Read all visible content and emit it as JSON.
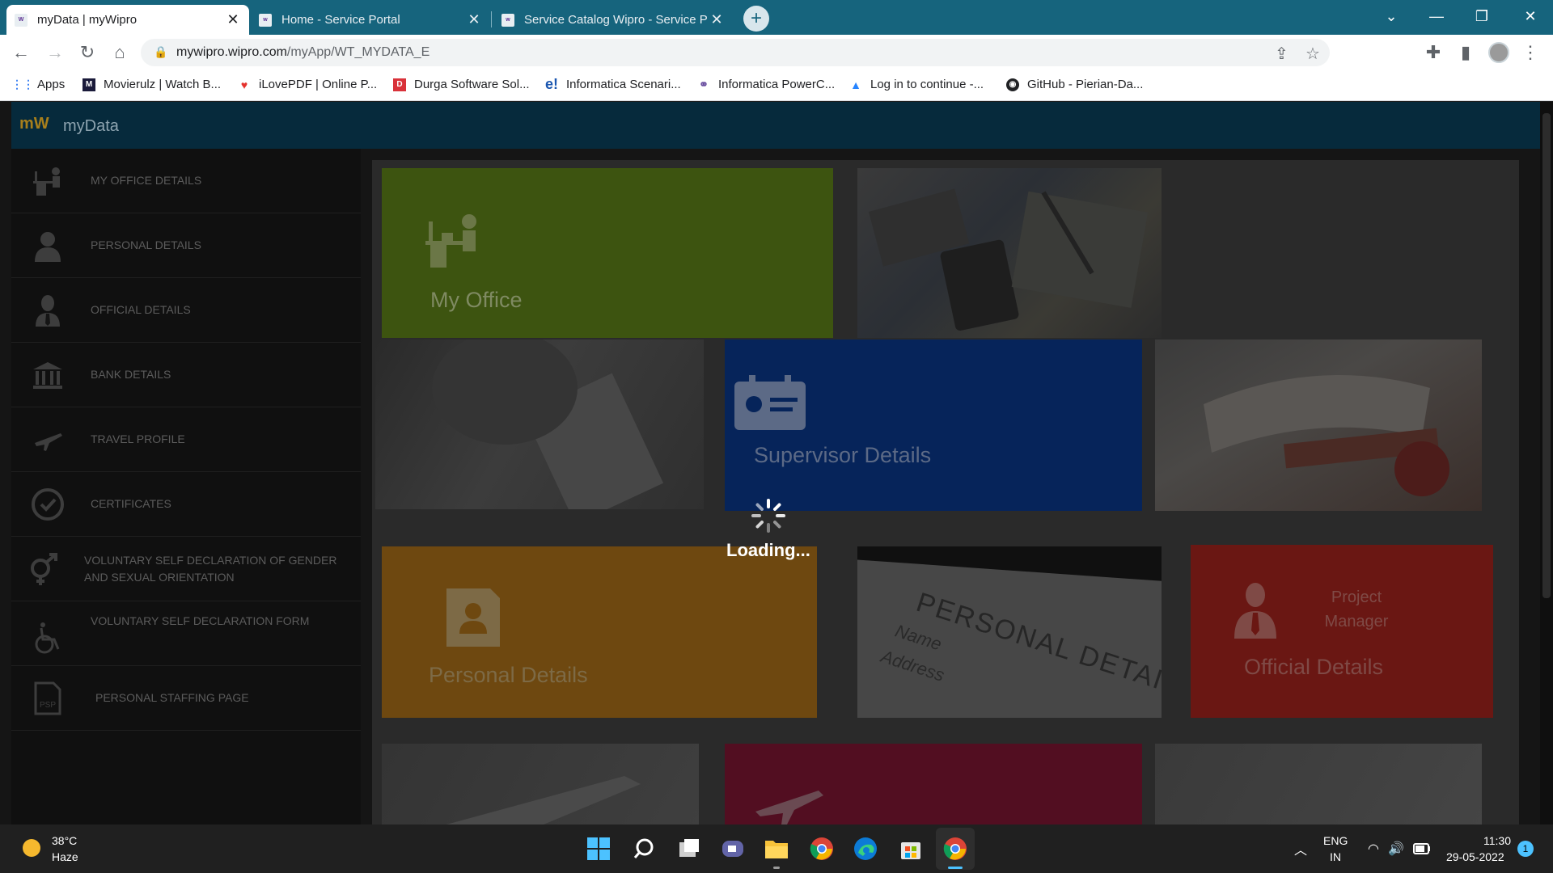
{
  "browser": {
    "tabs": [
      {
        "title": "myData | myWipro",
        "active": true
      },
      {
        "title": "Home - Service Portal",
        "active": false
      },
      {
        "title": "Service Catalog Wipro - Service P",
        "active": false
      }
    ],
    "url_host": "mywipro.wipro.com",
    "url_path": "/myApp/WT_MYDATA_E",
    "bookmarks": [
      {
        "label": "Apps",
        "icon": "apps-grid-icon"
      },
      {
        "label": "Movierulz | Watch B...",
        "icon": "movierulz-icon"
      },
      {
        "label": "iLovePDF | Online P...",
        "icon": "ilovepdf-heart-icon"
      },
      {
        "label": "Durga Software Sol...",
        "icon": "durga-icon"
      },
      {
        "label": "Informatica Scenari...",
        "icon": "informatica-e-icon"
      },
      {
        "label": "Informatica PowerC...",
        "icon": "informatica-power-icon"
      },
      {
        "label": "Log in to continue -...",
        "icon": "atlassian-icon"
      },
      {
        "label": "GitHub - Pierian-Da...",
        "icon": "github-icon"
      }
    ]
  },
  "app": {
    "logo": "mW",
    "name": "myData",
    "sidebar": [
      {
        "label": "MY OFFICE DETAILS",
        "icon": "desk-person-icon"
      },
      {
        "label": "PERSONAL DETAILS",
        "icon": "person-icon"
      },
      {
        "label": "OFFICIAL DETAILS",
        "icon": "person-tie-icon"
      },
      {
        "label": "BANK DETAILS",
        "icon": "bank-icon"
      },
      {
        "label": "TRAVEL PROFILE",
        "icon": "airplane-icon"
      },
      {
        "label": "CERTIFICATES",
        "icon": "certificate-icon"
      },
      {
        "label": "VOLUNTARY SELF DECLARATION OF GENDER AND SEXUAL ORIENTATION",
        "icon": "gender-icon"
      },
      {
        "label": "VOLUNTARY SELF DECLARATION FORM",
        "icon": "wheelchair-icon"
      },
      {
        "label": "PERSONAL STAFFING PAGE",
        "icon": "psp-document-icon"
      }
    ],
    "tiles": {
      "my_office": "My Office",
      "supervisor": "Supervisor Details",
      "personal": "Personal Details",
      "official": "Official Details",
      "official_sub1": "Project",
      "official_sub2": "Manager",
      "photo_personal_heading": "PERSONAL DETAILS",
      "photo_name": "Name",
      "photo_address": "Address"
    },
    "colors": {
      "my_office": "#3d5410",
      "supervisor": "#06245a",
      "personal": "#6e4810",
      "official": "#6a1713",
      "travel": "#520e21"
    },
    "loading": "Loading..."
  },
  "taskbar": {
    "weather_temp": "38°C",
    "weather_desc": "Haze",
    "lang1": "ENG",
    "lang2": "IN",
    "time": "11:30",
    "date": "29-05-2022",
    "notification_count": "1"
  }
}
